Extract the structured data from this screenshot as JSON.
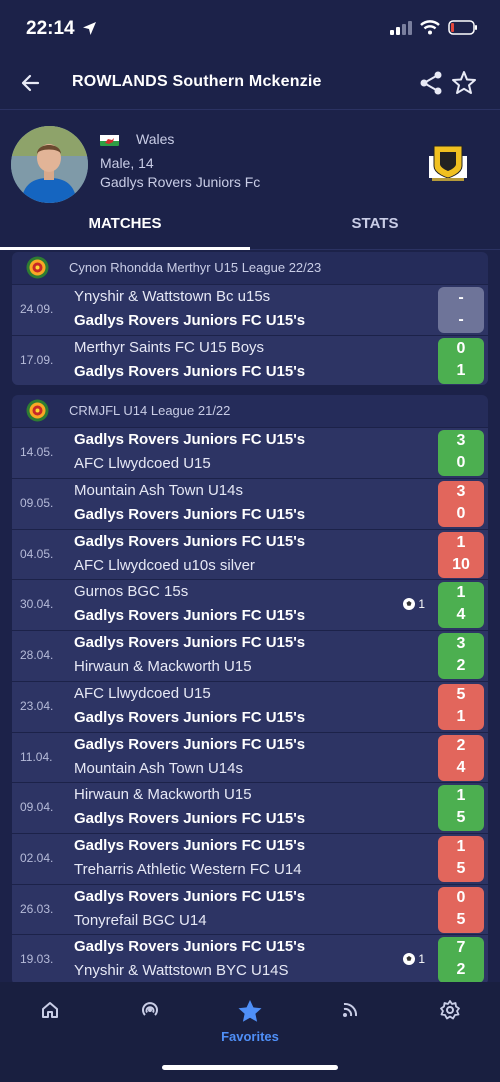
{
  "status_bar": {
    "time": "22:14"
  },
  "header": {
    "title": "ROWLANDS Southern Mckenzie"
  },
  "profile": {
    "country": "Wales",
    "gender_age": "Male, 14",
    "club": "Gadlys Rovers Juniors Fc"
  },
  "tabs": [
    {
      "label": "MATCHES",
      "active": true
    },
    {
      "label": "STATS",
      "active": false
    }
  ],
  "leagues": [
    {
      "name": "Cynon Rhondda Merthyr U15 League 22/23",
      "matches": [
        {
          "date": "24.09.",
          "home": "Ynyshir & Wattstown Bc u15s",
          "away": "Gadlys Rovers Juniors FC U15's",
          "home_score": "-",
          "away_score": "-",
          "result": "none",
          "player_side": "away",
          "goals": ""
        },
        {
          "date": "17.09.",
          "home": "Merthyr Saints FC U15 Boys",
          "away": "Gadlys Rovers Juniors FC U15's",
          "home_score": "0",
          "away_score": "1",
          "result": "win",
          "player_side": "away",
          "goals": ""
        }
      ]
    },
    {
      "name": "CRMJFL U14 League 21/22",
      "matches": [
        {
          "date": "14.05.",
          "home": "Gadlys Rovers Juniors FC U15's",
          "away": "AFC Llwydcoed U15",
          "home_score": "3",
          "away_score": "0",
          "result": "win",
          "player_side": "home",
          "goals": ""
        },
        {
          "date": "09.05.",
          "home": "Mountain Ash Town U14s",
          "away": "Gadlys Rovers Juniors FC U15's",
          "home_score": "3",
          "away_score": "0",
          "result": "loss",
          "player_side": "away",
          "goals": ""
        },
        {
          "date": "04.05.",
          "home": "Gadlys Rovers Juniors FC U15's",
          "away": "AFC Llwydcoed u10s silver",
          "home_score": "1",
          "away_score": "10",
          "result": "loss",
          "player_side": "home",
          "goals": ""
        },
        {
          "date": "30.04.",
          "home": "Gurnos BGC 15s",
          "away": "Gadlys Rovers Juniors FC U15's",
          "home_score": "1",
          "away_score": "4",
          "result": "win",
          "player_side": "away",
          "goals": "1"
        },
        {
          "date": "28.04.",
          "home": "Gadlys Rovers Juniors FC U15's",
          "away": "Hirwaun & Mackworth U15",
          "home_score": "3",
          "away_score": "2",
          "result": "win",
          "player_side": "home",
          "goals": ""
        },
        {
          "date": "23.04.",
          "home": "AFC Llwydcoed U15",
          "away": "Gadlys Rovers Juniors FC U15's",
          "home_score": "5",
          "away_score": "1",
          "result": "loss",
          "player_side": "away",
          "goals": ""
        },
        {
          "date": "11.04.",
          "home": "Gadlys Rovers Juniors FC U15's",
          "away": "Mountain Ash Town U14s",
          "home_score": "2",
          "away_score": "4",
          "result": "loss",
          "player_side": "home",
          "goals": ""
        },
        {
          "date": "09.04.",
          "home": "Hirwaun & Mackworth U15",
          "away": "Gadlys Rovers Juniors FC U15's",
          "home_score": "1",
          "away_score": "5",
          "result": "win",
          "player_side": "away",
          "goals": ""
        },
        {
          "date": "02.04.",
          "home": "Gadlys Rovers Juniors FC U15's",
          "away": "Treharris Athletic Western FC U14",
          "home_score": "1",
          "away_score": "5",
          "result": "loss",
          "player_side": "home",
          "goals": ""
        },
        {
          "date": "26.03.",
          "home": "Gadlys Rovers Juniors FC U15's",
          "away": "Tonyrefail BGC U14",
          "home_score": "0",
          "away_score": "5",
          "result": "loss",
          "player_side": "home",
          "goals": ""
        },
        {
          "date": "19.03.",
          "home": "Gadlys Rovers Juniors FC U15's",
          "away": "Ynyshir & Wattstown BYC U14S",
          "home_score": "7",
          "away_score": "2",
          "result": "win",
          "player_side": "home",
          "goals": "1"
        }
      ]
    }
  ],
  "bottom_nav": [
    {
      "icon": "home-icon",
      "label": ""
    },
    {
      "icon": "live-icon",
      "label": ""
    },
    {
      "icon": "star-icon",
      "label": "Favorites",
      "active": true
    },
    {
      "icon": "feed-icon",
      "label": ""
    },
    {
      "icon": "settings-icon",
      "label": ""
    }
  ],
  "colors": {
    "background": "#1c2249",
    "card": "#2d3464",
    "win": "#4caf50",
    "loss": "#e2665c",
    "accent": "#4f8ff7"
  }
}
